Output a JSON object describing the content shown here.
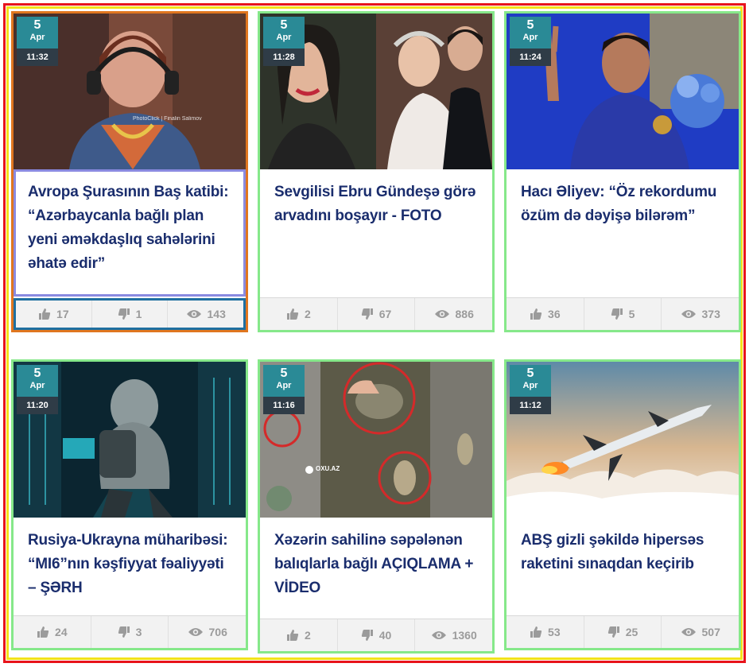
{
  "cards": [
    {
      "day": "5",
      "month": "Apr",
      "time": "11:32",
      "title": "Avropa Şurasının Baş katibi: “Azərbaycanla bağlı plan yeni əməkdaşlıq sahələrini əhatə edir”",
      "likes": "17",
      "dislikes": "1",
      "views": "143",
      "watermark": "PhotoClick | Finalin Salimov"
    },
    {
      "day": "5",
      "month": "Apr",
      "time": "11:28",
      "title": "Sevgilisi Ebru Gündeşə görə arvadını boşayır - FOTO",
      "likes": "2",
      "dislikes": "67",
      "views": "886"
    },
    {
      "day": "5",
      "month": "Apr",
      "time": "11:24",
      "title": "Hacı Əliyev: “Öz rekordumu özüm də dəyişə bilərəm”",
      "likes": "36",
      "dislikes": "5",
      "views": "373"
    },
    {
      "day": "5",
      "month": "Apr",
      "time": "11:20",
      "title": "Rusiya-Ukrayna müharibəsi: “MI6”nın kəşfiyyat fəaliyyəti – ŞƏRH",
      "likes": "24",
      "dislikes": "3",
      "views": "706"
    },
    {
      "day": "5",
      "month": "Apr",
      "time": "11:16",
      "title": "Xəzərin sahilinə səpələnən balıqlarla bağlı AÇIQLAMA + VİDEO",
      "likes": "2",
      "dislikes": "40",
      "views": "1360",
      "watermark": "OXU.AZ"
    },
    {
      "day": "5",
      "month": "Apr",
      "time": "11:12",
      "title": "ABŞ gizli şəkildə hipersəs raketini sınaqdan keçirib",
      "likes": "53",
      "dislikes": "25",
      "views": "507"
    }
  ],
  "colors": {
    "badge": "#2a8a96",
    "time_bg": "#2f3c47",
    "title": "#1a2d6d",
    "card_border": "#86e88a",
    "frame_red": "#e8141b",
    "frame_yellow": "#f3e11a"
  },
  "icons": {
    "likes": "thumbs-up-icon",
    "dislikes": "thumbs-down-icon",
    "views": "eye-icon"
  }
}
